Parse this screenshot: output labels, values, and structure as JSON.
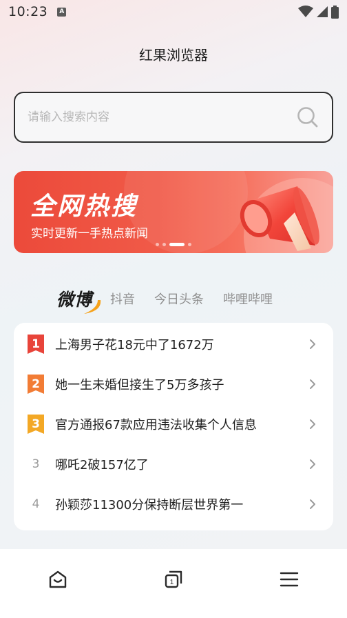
{
  "status_bar": {
    "time": "10:23",
    "notification_badge": "A",
    "icons": [
      "wifi-icon",
      "signal-icon",
      "battery-icon"
    ]
  },
  "header": {
    "title": "红果浏览器"
  },
  "search": {
    "placeholder": "请输入搜索内容",
    "value": ""
  },
  "banner": {
    "title": "全网热搜",
    "subtitle": "实时更新一手热点新闻",
    "dots_count": 4,
    "active_dot": 3
  },
  "tabs": [
    {
      "label": "微博",
      "active": true
    },
    {
      "label": "抖音",
      "active": false
    },
    {
      "label": "今日头条",
      "active": false
    },
    {
      "label": "哔哩哔哩",
      "active": false
    }
  ],
  "hot_list": [
    {
      "rank": "1",
      "text": "上海男子花18元中了1672万"
    },
    {
      "rank": "2",
      "text": "她一生未婚但接生了5万多孩子"
    },
    {
      "rank": "3",
      "text": "官方通报67款应用违法收集个人信息"
    },
    {
      "rank": "3",
      "text": "哪吒2破157亿了"
    },
    {
      "rank": "4",
      "text": "孙颖莎11300分保持断层世界第一"
    }
  ],
  "bottom_nav": {
    "tab_count": "1",
    "items": [
      "home-icon",
      "tabs-icon",
      "menu-icon"
    ]
  },
  "colors": {
    "rank1": "#e8443a",
    "rank2": "#f27c35",
    "rank3": "#f3a825",
    "banner": "#ec4a3a"
  }
}
